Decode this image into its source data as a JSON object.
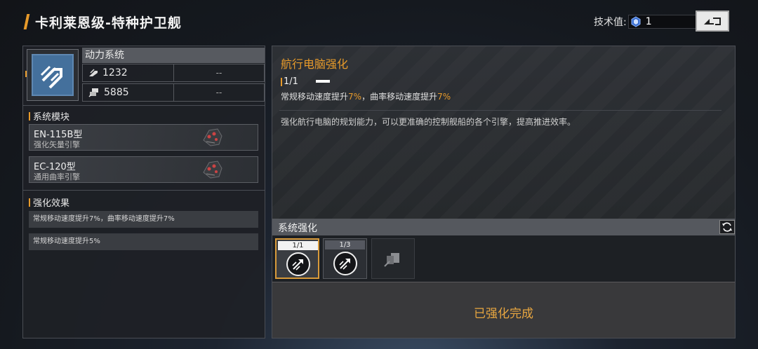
{
  "header": {
    "title": "卡利莱恩级-特种护卫舰",
    "tech_label": "技术值:",
    "tech_value": "1"
  },
  "left": {
    "system_name": "动力系统",
    "stats": [
      {
        "icon": "wing-icon",
        "value": "1232",
        "extra": "--"
      },
      {
        "icon": "thruster-icon",
        "value": "5885",
        "extra": "--"
      }
    ],
    "modules_title": "系统模块",
    "modules": [
      {
        "name": "EN-115B型",
        "desc": "强化矢量引擎"
      },
      {
        "name": "EC-120型",
        "desc": "通用曲率引擎"
      }
    ],
    "effects_title": "强化效果",
    "effects": [
      "常规移动速度提升7%，曲率移动速度提升7%",
      "常规移动速度提升5%"
    ]
  },
  "detail": {
    "title": "航行电脑强化",
    "level": "1/1",
    "effect_prefix_1": "常规移动速度提升",
    "effect_val_1": "7%",
    "effect_mid": "，曲率移动速度提升",
    "effect_val_2": "7%",
    "description": "强化航行电脑的规划能力，可以更准确的控制舰船的各个引擎，提高推进效率。"
  },
  "enhance": {
    "title": "系统强化",
    "slots": [
      {
        "badge": "1/1",
        "state": "selected"
      },
      {
        "badge": "1/3",
        "state": "normal"
      },
      {
        "badge": "",
        "state": "locked"
      }
    ],
    "status": "已强化完成"
  },
  "colors": {
    "accent": "#e79a2a",
    "status": "#e8a640"
  }
}
